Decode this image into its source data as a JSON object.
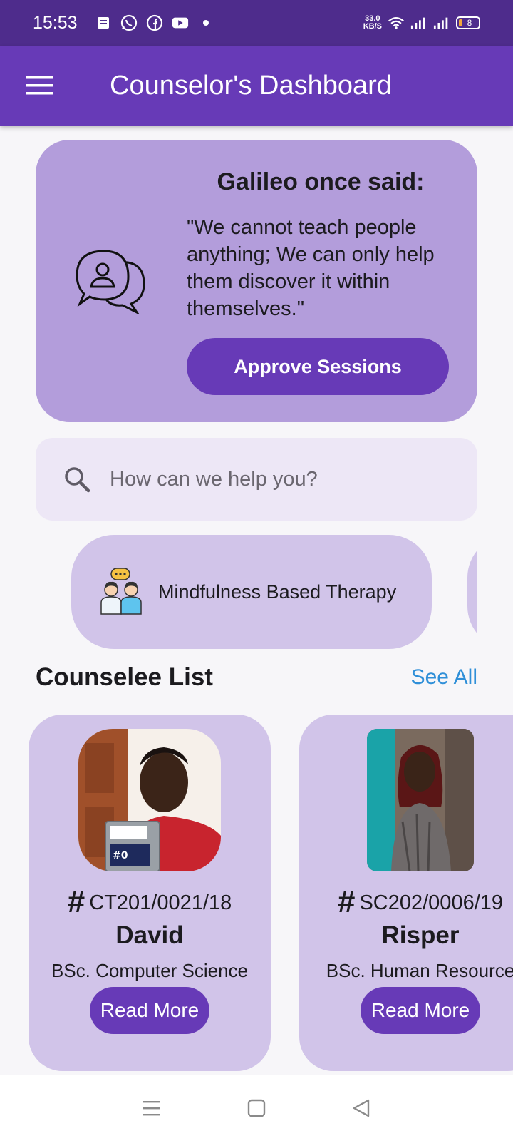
{
  "status_bar": {
    "time": "15:53",
    "net_speed_value": "33.0",
    "net_speed_unit": "KB/S",
    "battery": "8",
    "icons": [
      "message-icon",
      "whatsapp-icon",
      "facebook-icon",
      "youtube-icon",
      "dot-icon",
      "wifi-icon",
      "signal-icon",
      "signal-icon",
      "battery-icon"
    ]
  },
  "app_bar": {
    "title": "Counselor's Dashboard",
    "menu_icon": "hamburger-menu-icon",
    "color": "#673ab7"
  },
  "quote_card": {
    "heading": "Galileo once said:",
    "quote": "\"We cannot teach people anything; We can only help them discover it within themselves.\"",
    "button_label": "Approve Sessions",
    "icon": "chat-bubbles-person-icon",
    "color": "#b39ddb"
  },
  "search": {
    "placeholder": "How can we help you?",
    "icon": "search-icon"
  },
  "categories": [
    {
      "label": "Mindfulness Based Therapy",
      "icon": "counselor-people-icon"
    },
    {
      "label": ""
    }
  ],
  "counselee_section": {
    "title": "Counselee List",
    "see_all": "See All"
  },
  "counselees": [
    {
      "reg": "CT201/0021/18",
      "name": "David",
      "course": "BSc. Computer Science",
      "button": "Read More"
    },
    {
      "reg": "SC202/0006/19",
      "name": "Risper",
      "course": "BSc. Human Resource",
      "button": "Read More"
    }
  ],
  "nav_bar": {
    "icons": [
      "recent-apps-icon",
      "home-icon",
      "back-icon"
    ]
  }
}
